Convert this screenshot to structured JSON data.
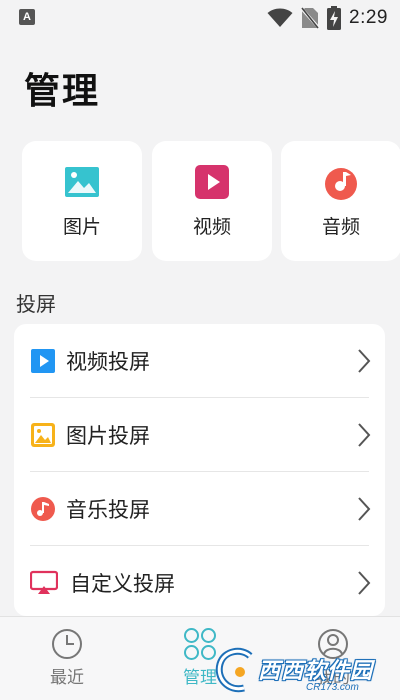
{
  "status_bar": {
    "notification_icon_letter": "A",
    "time": "2:29"
  },
  "page": {
    "title": "管理"
  },
  "media_cards": [
    {
      "label": "图片",
      "icon": "image-icon",
      "color": "#36c3cf"
    },
    {
      "label": "视频",
      "icon": "video-play-icon",
      "color": "#d6336c"
    },
    {
      "label": "音频",
      "icon": "music-note-icon",
      "color": "#ef5a4e"
    }
  ],
  "cast_section": {
    "title": "投屏",
    "items": [
      {
        "label": "视频投屏",
        "icon": "video-play-icon",
        "color": "#2196f3"
      },
      {
        "label": "图片投屏",
        "icon": "image-icon",
        "color": "#f7b21a"
      },
      {
        "label": "音乐投屏",
        "icon": "music-note-icon",
        "color": "#ef5a4e"
      },
      {
        "label": "自定义投屏",
        "icon": "screen-cast-icon",
        "color": "#e0325c"
      }
    ]
  },
  "bottom_nav": {
    "accent_color": "#3fb8c6",
    "items": [
      {
        "label": "最近",
        "icon": "clock-icon",
        "active": false
      },
      {
        "label": "管理",
        "icon": "grid-icon",
        "active": true
      },
      {
        "label": "我的",
        "icon": "user-icon",
        "active": false
      }
    ]
  },
  "watermark": {
    "text": "西西软件园",
    "sub": "CR173.com"
  }
}
